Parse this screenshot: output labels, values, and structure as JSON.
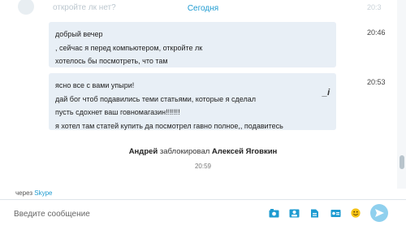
{
  "window": {
    "title": "Skype"
  },
  "history_hint": {
    "text": "откройте лк нет?",
    "time": "20:3"
  },
  "date_separator": "Сегодня",
  "messages": [
    {
      "lines": [
        "добрый вечер",
        ", сейчас я перед компьютером, откройте лк",
        "хотелось бы посмотреть, что там"
      ],
      "time": "20:46"
    },
    {
      "lines": [
        "ясно все с вами упыри!",
        "дай бог чтоб подавились теми статьями, которые я сделал",
        "пусть сдохнет ваш говномагазин!!!!!!!",
        "я хотел там статей купить да посмотрел гавно полное,, подавитесь"
      ],
      "time": "20:53"
    }
  ],
  "system_event": {
    "actor": "Андрей",
    "action": "заблокировал",
    "target": "Алексей Яговкин",
    "time": "20:59"
  },
  "footer": {
    "via_prefix": "через",
    "via_link": "Skype"
  },
  "compose": {
    "placeholder": "Введите сообщение"
  },
  "toolbar": {
    "icons": [
      "send-photo-icon",
      "send-contact-icon",
      "send-file-icon",
      "send-video-message-icon",
      "emoticons-icon"
    ],
    "send_icon": "send-icon"
  },
  "colors": {
    "accent": "#1e9bd1",
    "bubble": "#e8eff6",
    "send": "#8fd0ee"
  }
}
